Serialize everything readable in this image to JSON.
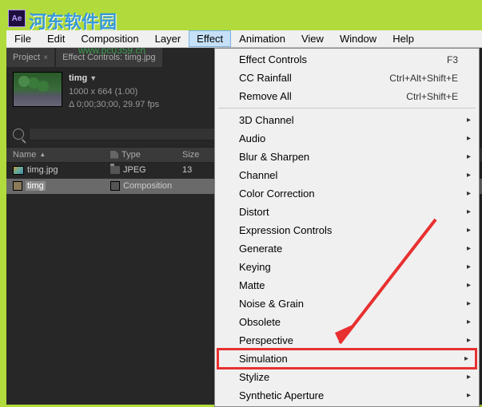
{
  "watermark": {
    "text": "河东软件园",
    "url": "www.pc0359.cn"
  },
  "menubar": [
    "File",
    "Edit",
    "Composition",
    "Layer",
    "Effect",
    "Animation",
    "View",
    "Window",
    "Help"
  ],
  "menu_active_index": 4,
  "dropdown": {
    "top": [
      {
        "label": "Effect Controls",
        "shortcut": "F3"
      },
      {
        "label": "CC Rainfall",
        "shortcut": "Ctrl+Alt+Shift+E"
      },
      {
        "label": "Remove All",
        "shortcut": "Ctrl+Shift+E"
      }
    ],
    "categories": [
      "3D Channel",
      "Audio",
      "Blur & Sharpen",
      "Channel",
      "Color Correction",
      "Distort",
      "Expression Controls",
      "Generate",
      "Keying",
      "Matte",
      "Noise & Grain",
      "Obsolete",
      "Perspective",
      "Simulation",
      "Stylize",
      "Synthetic Aperture"
    ],
    "highlight_index": 13
  },
  "panels": {
    "project_tab": "Project",
    "effect_controls_tab": "Effect Controls: timg.jpg"
  },
  "project": {
    "item_name": "timg",
    "dims": "1000 x 664 (1.00)",
    "duration": "Δ 0;00;30;00, 29.97 fps"
  },
  "search": {
    "placeholder": ""
  },
  "columns": {
    "name": "Name",
    "type": "Type",
    "size": "Size"
  },
  "rows": [
    {
      "name": "timg.jpg",
      "type": "JPEG",
      "size": "13",
      "icon": "img"
    },
    {
      "name": "timg",
      "type": "Composition",
      "size": "",
      "icon": "comp",
      "selected": true
    }
  ]
}
